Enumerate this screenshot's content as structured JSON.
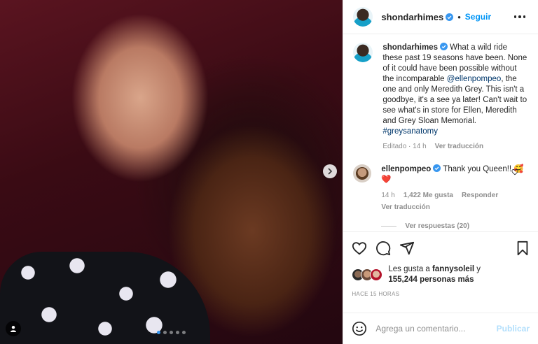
{
  "post": {
    "author": "shondarhimes",
    "follow_label": "Seguir",
    "separator": "•",
    "caption": {
      "before_mention": "What a wild ride these past 19 seasons have been. None of it could have been possible without the incomparable ",
      "mention": "@ellenpompeo",
      "after_mention": ", the one and only Meredith Grey. This isn't a goodbye, it's a see ya later! Can't wait to see what's in store for Ellen, Meredith and Grey Sloan Memorial. ",
      "hashtag": "#greysanatomy"
    },
    "caption_meta": {
      "edited": "Editado · 14 h",
      "see_translation": "Ver traducción"
    },
    "reply": {
      "username": "ellenpompeo",
      "text": "Thank you Queen!! 🥰❤️",
      "time": "14 h",
      "likes": "1,422 Me gusta",
      "reply_label": "Responder",
      "see_translation": "Ver traducción"
    },
    "view_replies": "Ver respuestas (20)",
    "likes_line_prefix": "Les gusta a ",
    "liked_by": "fannysoleil",
    "likes_line_join": " y",
    "others": "155,244 personas más",
    "time_ago": "HACE 15 HORAS",
    "comment_placeholder": "Agrega un comentario...",
    "publish_label": "Publicar"
  },
  "carousel": {
    "slide_count": 5,
    "active_index": 0
  },
  "colors": {
    "link": "#0095f6",
    "verified": "#3897f0",
    "heart": "#ed4956"
  },
  "icons": [
    "heart-icon",
    "comment-icon",
    "share-icon",
    "bookmark-icon",
    "emoji-icon",
    "more-icon",
    "chevron-right-icon",
    "user-tag-icon"
  ]
}
